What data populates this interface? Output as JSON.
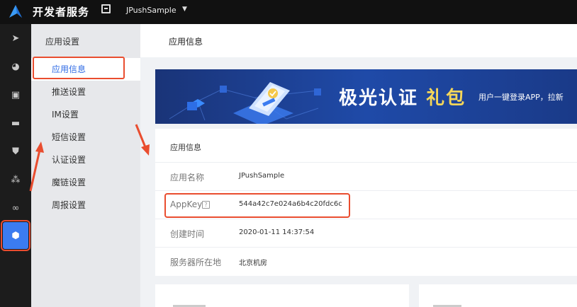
{
  "topbar": {
    "brand": "开发者服务",
    "app_name": "JPushSample",
    "caret": "▼"
  },
  "rail": {
    "items": [
      {
        "icon": "send-icon",
        "glyph": "➤"
      },
      {
        "icon": "stats-icon",
        "glyph": "◕"
      },
      {
        "icon": "device-icon",
        "glyph": "▣"
      },
      {
        "icon": "message-icon",
        "glyph": "▬"
      },
      {
        "icon": "shield-icon",
        "glyph": "⛊"
      },
      {
        "icon": "nodes-icon",
        "glyph": "⁂"
      },
      {
        "icon": "link-icon",
        "glyph": "∞"
      },
      {
        "icon": "settings-icon",
        "glyph": "⬢"
      }
    ]
  },
  "sidebar": {
    "heading": "应用设置",
    "items": [
      {
        "label": "应用信息"
      },
      {
        "label": "推送设置"
      },
      {
        "label": "IM设置"
      },
      {
        "label": "短信设置"
      },
      {
        "label": "认证设置"
      },
      {
        "label": "魔链设置"
      },
      {
        "label": "周报设置"
      }
    ]
  },
  "page": {
    "title": "应用信息"
  },
  "banner": {
    "title": "极光认证",
    "title_highlight": "礼包",
    "subtitle": "用户一键登录APP，拉新"
  },
  "info_card": {
    "title": "应用信息",
    "rows": [
      {
        "label": "应用名称",
        "value": "JPushSample"
      },
      {
        "label": "AppKey",
        "value": "544a42c7e024a6b4c20fdc6c",
        "help": "?"
      },
      {
        "label": "创建时间",
        "value": "2020-01-11 14:37:54"
      },
      {
        "label": "服务器所在地",
        "value": "北京机房"
      }
    ]
  },
  "colors": {
    "accent": "#2f6be5",
    "highlight_box": "#e94d2f",
    "rail_active": "#3b7cf0",
    "banner_bg": "#1d3f8e",
    "banner_gift": "#f5d659"
  }
}
